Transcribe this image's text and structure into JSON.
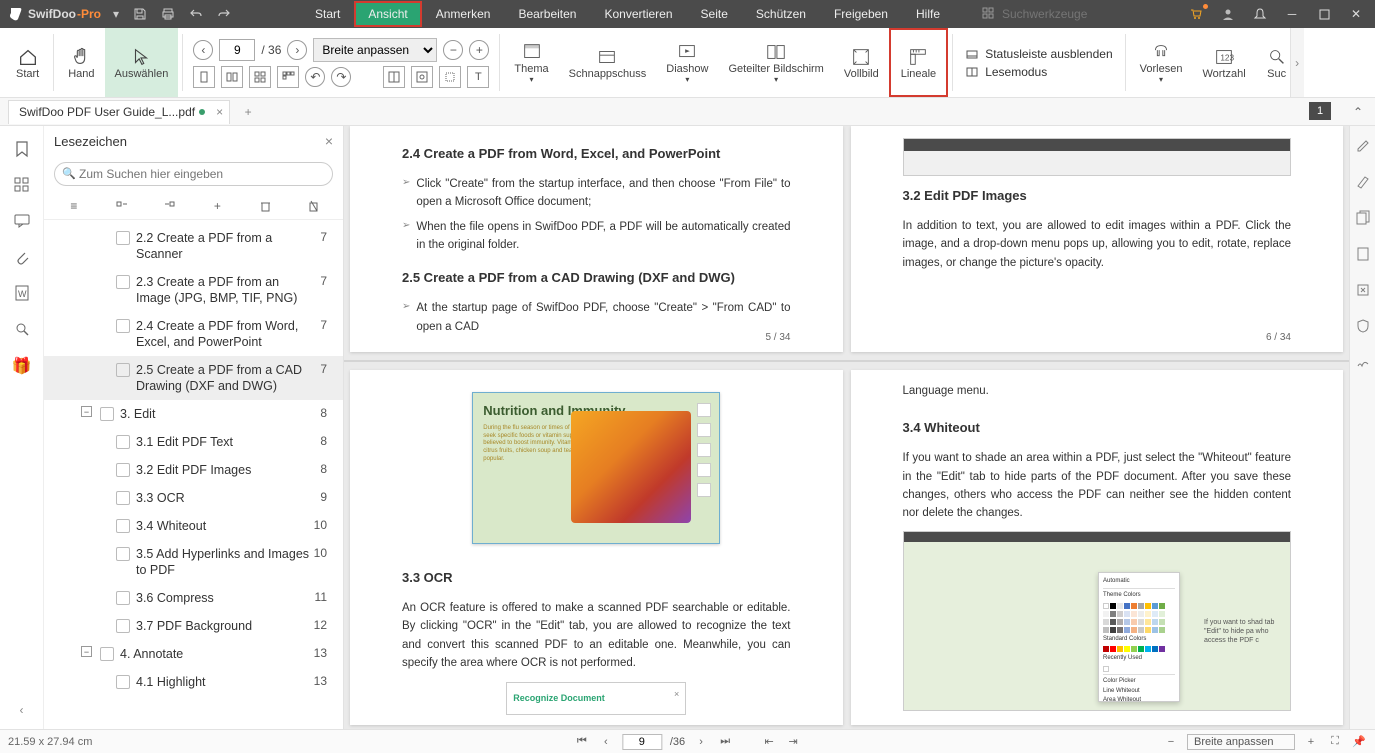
{
  "app": {
    "name": "SwifDoo",
    "suffix": "-Pro"
  },
  "menu": [
    "Start",
    "Ansicht",
    "Anmerken",
    "Bearbeiten",
    "Konvertieren",
    "Seite",
    "Schützen",
    "Freigeben",
    "Hilfe"
  ],
  "activeMenu": 1,
  "searchPlaceholder": "Suchwerkzeuge",
  "ribbon": {
    "start": "Start",
    "hand": "Hand",
    "select": "Auswählen",
    "pageCurrent": "9",
    "pageTotal": "/ 36",
    "zoomSel": "Breite anpassen",
    "theme": "Thema",
    "snapshot": "Schnappschuss",
    "diashow": "Diashow",
    "split": "Geteilter Bildschirm",
    "fullscreen": "Vollbild",
    "rulers": "Lineale",
    "hideStatus": "Statusleiste ausblenden",
    "readMode": "Lesemodus",
    "readAloud": "Vorlesen",
    "wordCount": "Wortzahl",
    "searchTrunc": "Suc"
  },
  "tab": {
    "name": "SwifDoo PDF User Guide_L...pdf",
    "jump": "1"
  },
  "panel": {
    "title": "Lesezeichen",
    "searchPlaceholder": "Zum Suchen hier eingeben",
    "items": [
      {
        "level": 2,
        "text": "2.2 Create a PDF from a Scanner",
        "page": "7"
      },
      {
        "level": 2,
        "text": "2.3 Create a PDF from an Image (JPG, BMP, TIF, PNG)",
        "page": "7"
      },
      {
        "level": 2,
        "text": "2.4 Create a PDF from Word, Excel, and PowerPoint",
        "page": "7"
      },
      {
        "level": 2,
        "text": "2.5 Create a PDF from a CAD Drawing (DXF and DWG)",
        "page": "7",
        "sel": true
      },
      {
        "level": 1,
        "text": "3. Edit",
        "page": "8",
        "collapse": true
      },
      {
        "level": 2,
        "text": "3.1 Edit PDF Text",
        "page": "8"
      },
      {
        "level": 2,
        "text": "3.2 Edit PDF Images",
        "page": "8"
      },
      {
        "level": 2,
        "text": "3.3 OCR",
        "page": "9"
      },
      {
        "level": 2,
        "text": "3.4 Whiteout",
        "page": "10"
      },
      {
        "level": 2,
        "text": "3.5 Add Hyperlinks and Images to PDF",
        "page": "10"
      },
      {
        "level": 2,
        "text": "3.6 Compress",
        "page": "11"
      },
      {
        "level": 2,
        "text": "3.7 PDF Background",
        "page": "12"
      },
      {
        "level": 1,
        "text": "4. Annotate",
        "page": "13",
        "collapse": true
      },
      {
        "level": 2,
        "text": "4.1 Highlight",
        "page": "13"
      }
    ]
  },
  "doc": {
    "p5": {
      "h24": "2.4 Create a PDF from Word, Excel, and PowerPoint",
      "b241": "Click \"Create\" from the startup interface, and then choose \"From File\" to open a Microsoft Office document;",
      "b242": "When the file opens in SwifDoo PDF, a PDF will be automatically created in the original folder.",
      "h25": "2.5 Create a PDF from a CAD Drawing (DXF and DWG)",
      "b251": "At the startup page of SwifDoo PDF, choose \"Create\" > \"From CAD\" to open a CAD",
      "foot": "5 / 34"
    },
    "p6": {
      "h32": "3.2 Edit PDF Images",
      "p321": "In addition to text, you are allowed to edit images within a PDF. Click the image, and a drop-down menu pops up, allowing you to edit, rotate, replace images, or change the picture's opacity.",
      "foot": "6 / 34"
    },
    "p7": {
      "imgTitle": "Nutrition and Immunity",
      "h33": "3.3 OCR",
      "p331": "An OCR feature is offered to make a scanned PDF searchable or editable. By clicking \"OCR\" in the \"Edit\" tab, you are allowed to recognize the text and convert this scanned PDF to an editable one. Meanwhile, you can specify the area where OCR is not performed.",
      "recDoc": "Recognize Document"
    },
    "p8": {
      "lang": "Language menu.",
      "h34": "3.4 Whiteout",
      "p341": "If you want to shade an area within a PDF, just select the \"Whiteout\" feature in the \"Edit\" tab to hide parts of the PDF document. After you save these changes, others who access the PDF can neither see the hidden content nor delete the changes.",
      "co": "If you want to shad tab \"Edit\" to hide pa who access the PDF c",
      "pThemeColors": "Theme Colors",
      "pStandard": "Standard Colors",
      "pRecent": "Recently Used",
      "pColorPicker": "Color Picker",
      "pLineWhiteout": "Line Whiteout",
      "pAreaWhiteout": "Area Whiteout",
      "pAutomatic": "Automatic"
    }
  },
  "status": {
    "dim": "21.59 x 27.94 cm",
    "page": "9",
    "total": "/36",
    "zoom": "Breite anpassen"
  }
}
